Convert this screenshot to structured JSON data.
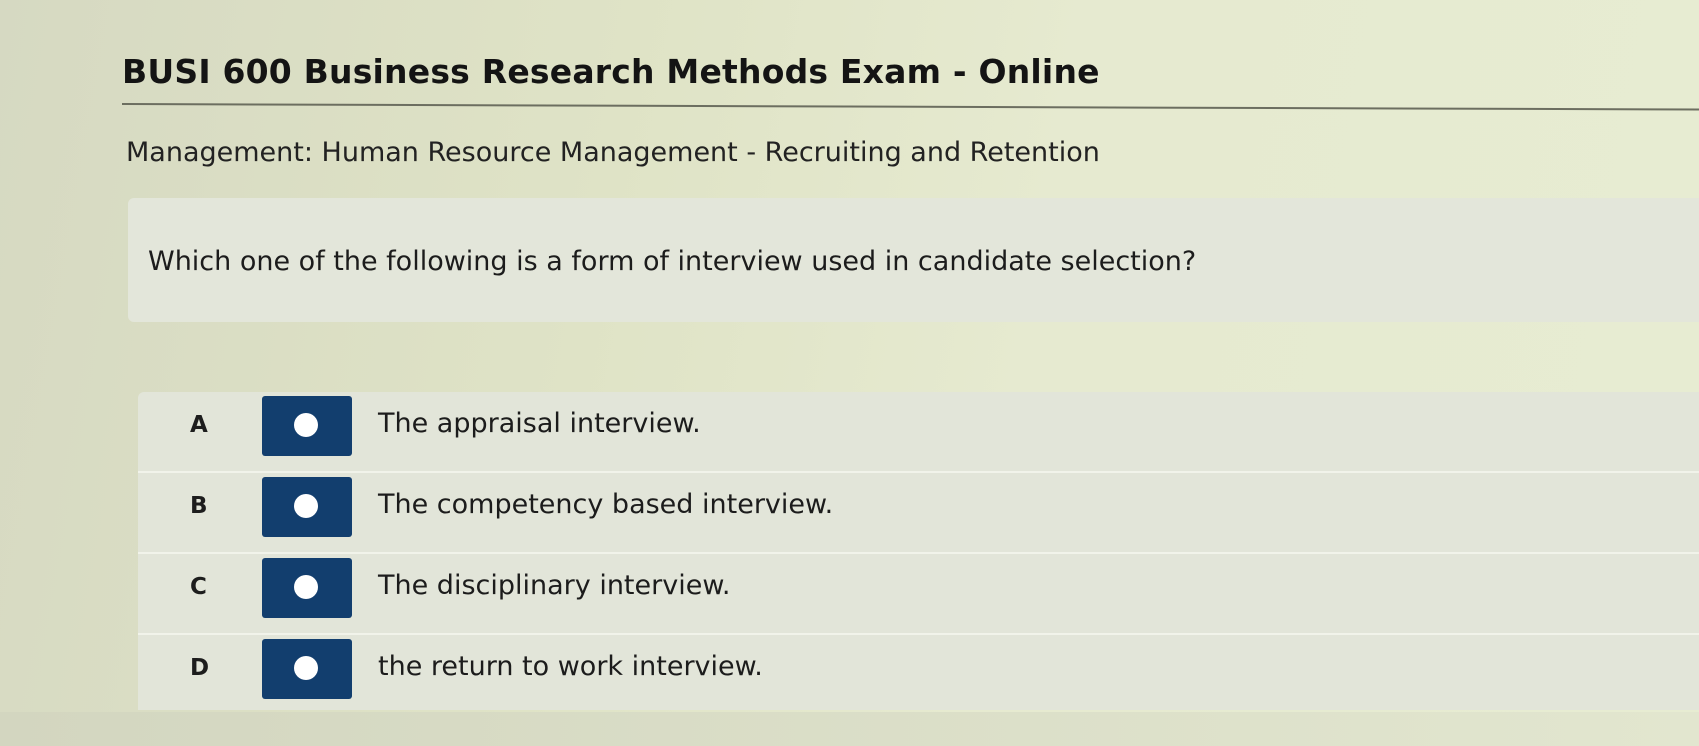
{
  "exam": {
    "title": "BUSI 600 Business Research Methods Exam - Online",
    "category": "Management: Human Resource Management - Recruiting and Retention"
  },
  "question": {
    "text": "Which one of the following is a form of interview used in candidate selection?"
  },
  "options": [
    {
      "letter": "A",
      "text": "The appraisal interview."
    },
    {
      "letter": "B",
      "text": "The competency based interview."
    },
    {
      "letter": "C",
      "text": "The disciplinary interview."
    },
    {
      "letter": "D",
      "text": "the return to work interview."
    }
  ],
  "colors": {
    "radio_background": "#123e6e",
    "radio_dot": "#ffffff"
  }
}
